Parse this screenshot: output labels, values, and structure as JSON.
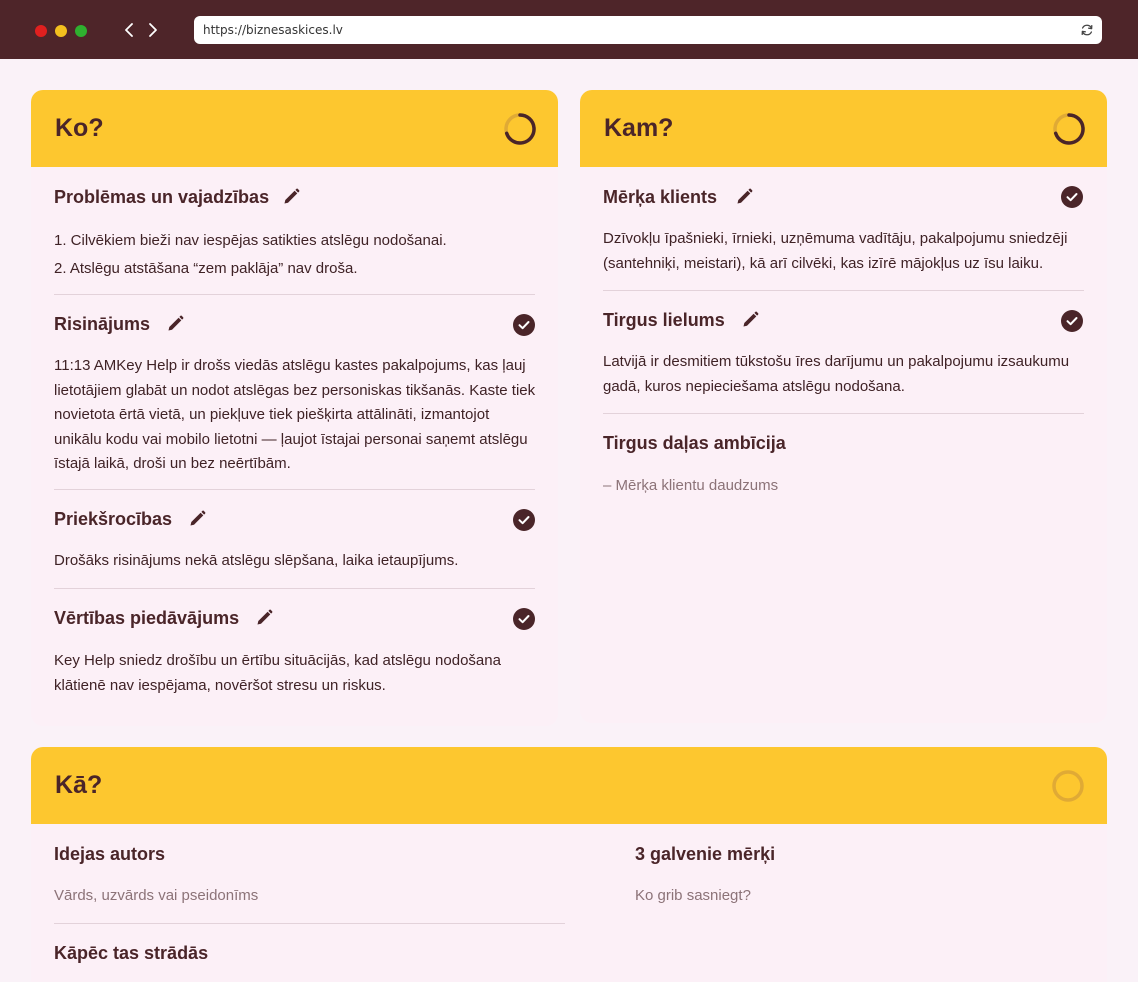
{
  "browser": {
    "url": "https://biznesaskices.lv"
  },
  "ko": {
    "title": "Ko?",
    "sections": [
      {
        "title": "Problēmas un vajadzības",
        "lines": [
          "1. Cilvēkiem bieži nav iespējas satikties atslēgu nodošanai.",
          "2. Atslēgu atstāšana “zem paklāja” nav droša."
        ]
      },
      {
        "title": "Risinājums",
        "text": "11:13 AMKey Help ir drošs viedās atslēgu kastes pakalpojums, kas ļauj lietotājiem glabāt un nodot atslēgas bez personiskas tikšanās. Kaste tiek novietota ērtā vietā, un piekļuve tiek piešķirta attālināti, izmantojot unikālu kodu vai mobilo lietotni — ļaujot īstajai personai saņemt atslēgu īstajā laikā, droši un bez neērtībām."
      },
      {
        "title": "Priekšrocības",
        "text": "Drošāks risinājums nekā atslēgu slēpšana, laika ietaupījums."
      },
      {
        "title": "Vērtības piedāvājums",
        "text": "Key Help sniedz drošību un ērtību situācijās, kad atslēgu nodošana klātienē nav iespējama, novēršot stresu un riskus."
      }
    ]
  },
  "kam": {
    "title": "Kam?",
    "sections": [
      {
        "title": "Mērķa klients",
        "text": "Dzīvokļu īpašnieki, īrnieki, uzņēmuma vadītāju, pakalpojumu sniedzēji (santehniķi, meistari), kā arī cilvēki, kas izīrē mājokļus uz īsu laiku."
      },
      {
        "title": "Tirgus lielums",
        "text": "Latvijā ir desmitiem tūkstošu īres darījumu un pakalpojumu izsaukumu gadā, kuros nepieciešama atslēgu nodošana."
      },
      {
        "title": "Tirgus daļas ambīcija",
        "placeholder": "– Mērķa klientu daudzums"
      }
    ]
  },
  "ka": {
    "title": "Kā?",
    "sections": [
      {
        "title": "Idejas autors",
        "placeholder": "Vārds, uzvārds vai pseidonīms"
      },
      {
        "title": "3 galvenie mērķi",
        "placeholder": "Ko grib sasniegt?"
      },
      {
        "title": "Kāpēc tas strādās"
      }
    ]
  },
  "colors": {
    "chrome": "#4e2529",
    "header": "#fdc72f",
    "card": "#fcf0f7",
    "page": "#faf2f8",
    "text": "#4a2529"
  },
  "icons": {
    "edit": "pencil-icon",
    "done": "check-circle-icon",
    "progress": "progress-ring-icon"
  }
}
